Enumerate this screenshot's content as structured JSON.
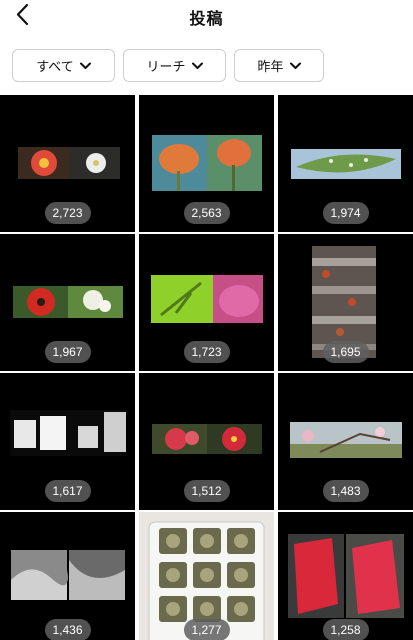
{
  "header": {
    "title": "投稿",
    "back_icon": "chevron-left-icon"
  },
  "filters": [
    {
      "label": "すべて",
      "icon": "chevron-down-icon"
    },
    {
      "label": "リーチ",
      "icon": "chevron-down-icon"
    },
    {
      "label": "昨年",
      "icon": "chevron-down-icon"
    }
  ],
  "posts": [
    {
      "reach": "2,723"
    },
    {
      "reach": "2,563"
    },
    {
      "reach": "1,974"
    },
    {
      "reach": "1,967"
    },
    {
      "reach": "1,723"
    },
    {
      "reach": "1,695"
    },
    {
      "reach": "1,617"
    },
    {
      "reach": "1,512"
    },
    {
      "reach": "1,483"
    },
    {
      "reach": "1,436"
    },
    {
      "reach": "1,277"
    },
    {
      "reach": "1,258"
    }
  ]
}
